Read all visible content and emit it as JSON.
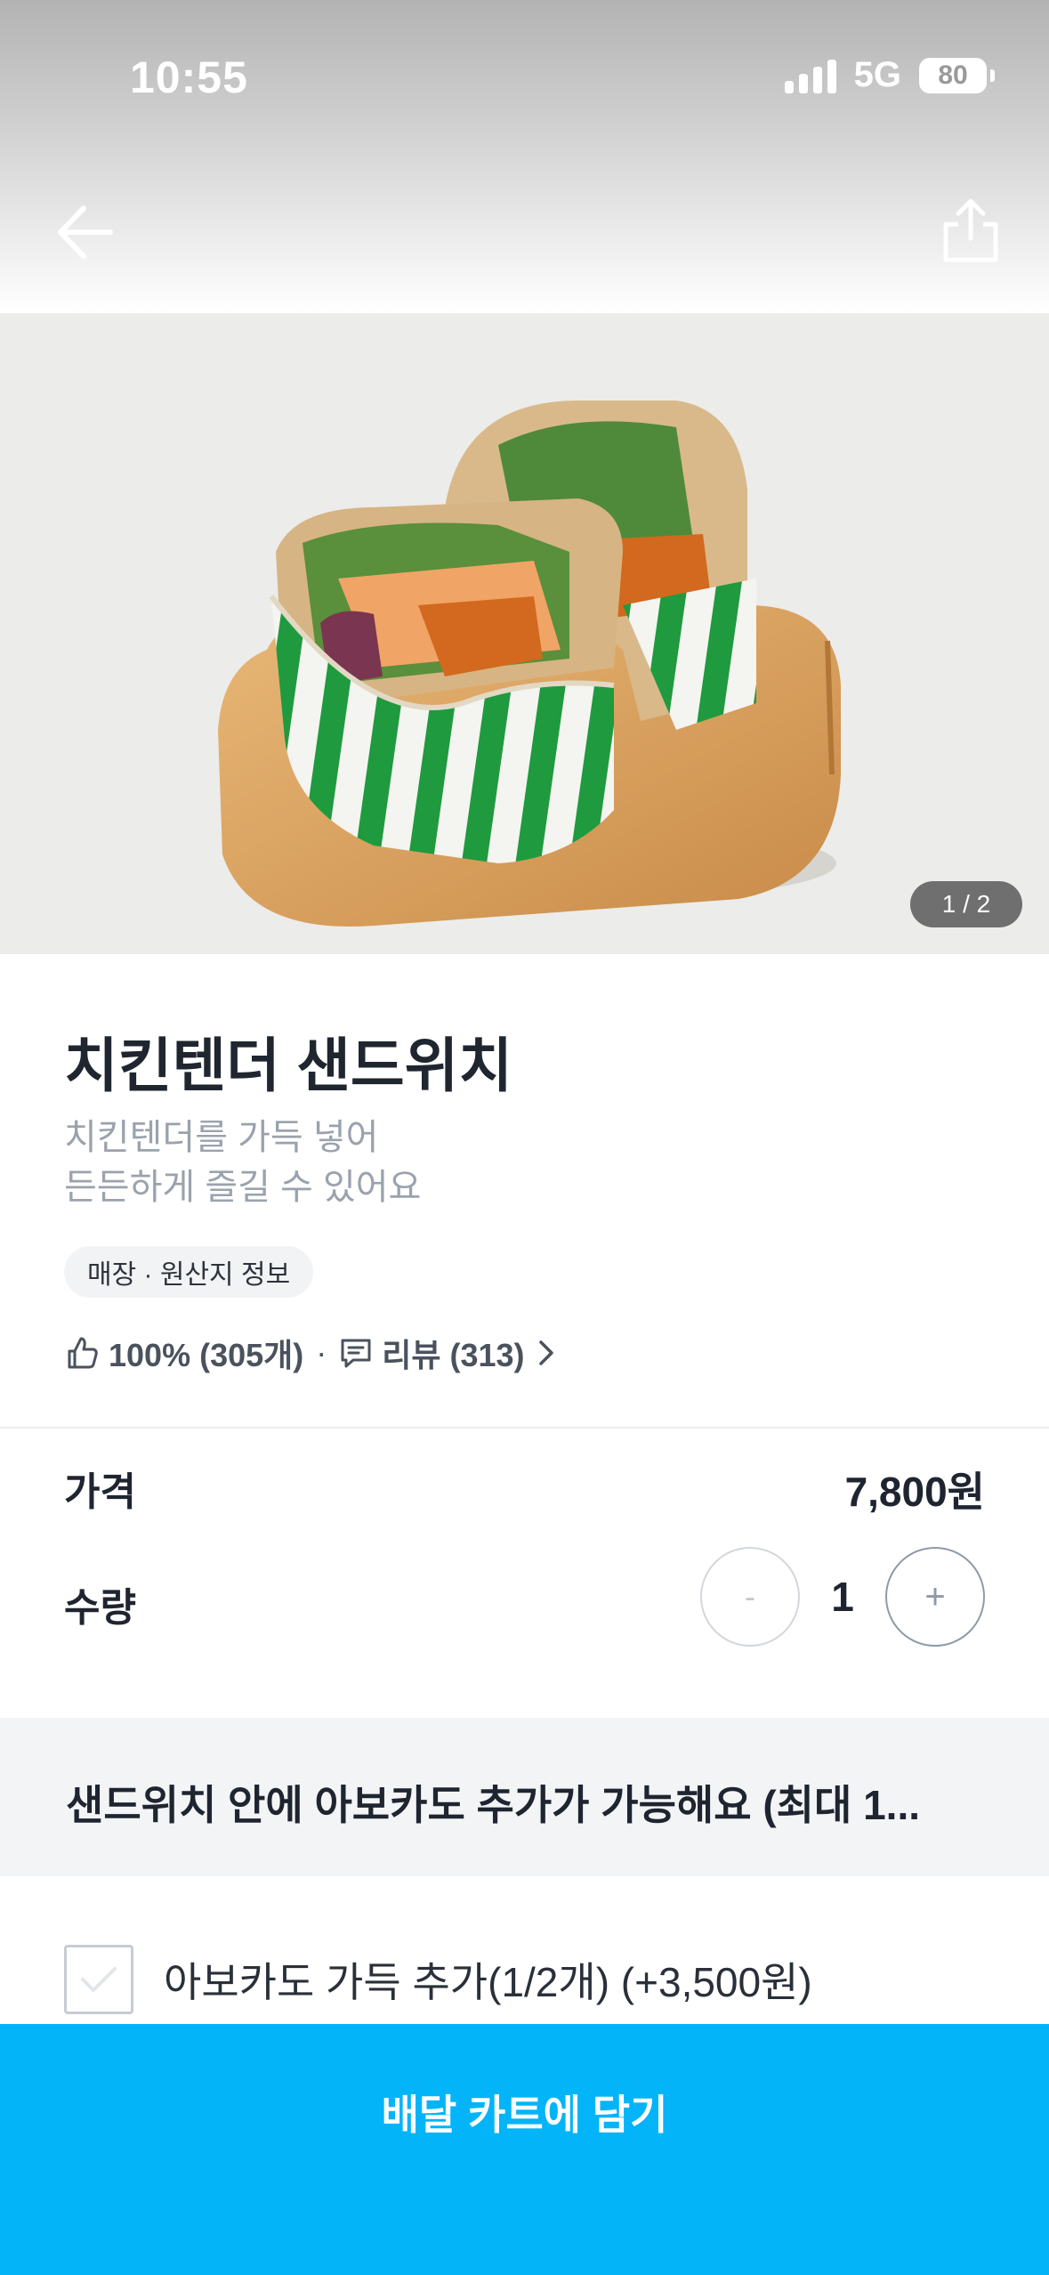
{
  "status_bar": {
    "time": "10:55",
    "network": "5G",
    "battery": "80"
  },
  "hero": {
    "counter": "1 / 2"
  },
  "product": {
    "name": "치킨텐더 샌드위치",
    "description_lines": [
      "치킨텐더를 가득 넣어",
      "든든하게 즐길 수 있어요"
    ],
    "origin_button": "매장 · 원산지 정보",
    "rating": "100% (305개)",
    "separator": "·",
    "reviews": "리뷰 (313)"
  },
  "price": {
    "label": "가격",
    "value": "7,800원"
  },
  "quantity": {
    "label": "수량",
    "value": "1",
    "minus": "-",
    "plus": "+"
  },
  "options": {
    "header": "샌드위치 안에 아보카도 추가가 가능해요 (최대 1...",
    "items": [
      {
        "label": "아보카도 가득 추가(1/2개) (+3,500원)",
        "checked": false
      }
    ]
  },
  "cta": {
    "label": "배달 카트에 담기"
  },
  "colors": {
    "accent": "#04b4f9",
    "wrapper_green": "#1f9a3e"
  }
}
